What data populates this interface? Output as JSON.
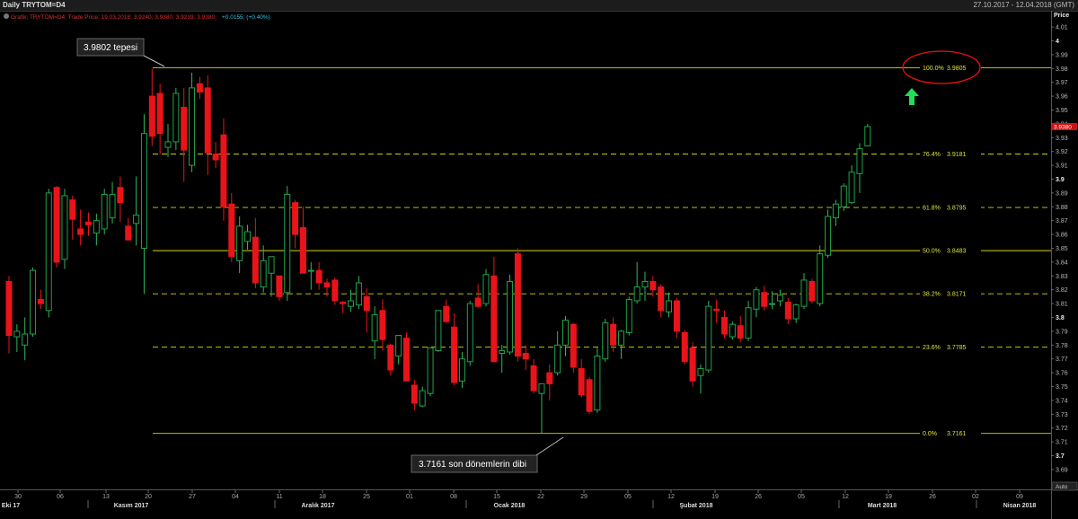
{
  "window": {
    "title": "Daily TRYTOM=D4",
    "date_range": "27.10.2017 - 12.04.2018 (GMT)"
  },
  "legend_line": {
    "prefix": "Grafik; TRYTOM=D4; Trade Price; 19.03.2018; 3.9240; 3.9380; 3.9239; 3.9380;",
    "change": "+0.0155; (+0.40%)"
  },
  "price_axis": {
    "title": "Price",
    "current_price": "3.9380",
    "ticks": [
      "4.01",
      "4",
      "3.99",
      "3.98",
      "3.97",
      "3.96",
      "3.95",
      "3.94",
      "3.93",
      "3.92",
      "3.91",
      "3.9",
      "3.89",
      "3.88",
      "3.87",
      "3.86",
      "3.85",
      "3.84",
      "3.83",
      "3.82",
      "3.81",
      "3.8",
      "3.79",
      "3.78",
      "3.77",
      "3.76",
      "3.75",
      "3.74",
      "3.73",
      "3.72",
      "3.71",
      "3.7",
      "3.69"
    ],
    "bold_ticks": [
      "4",
      "3.9",
      "3.8",
      "3.7"
    ]
  },
  "time_axis": {
    "day_ticks": [
      "30",
      "06",
      "13",
      "20",
      "27",
      "04",
      "11",
      "18",
      "25",
      "01",
      "08",
      "15",
      "22",
      "29",
      "05",
      "12",
      "19",
      "26",
      "05",
      "12",
      "19",
      "26",
      "02",
      "09"
    ],
    "month_labels": [
      "Eki 17",
      "Kasım 2017",
      "Aralık 2017",
      "Ocak 2018",
      "Şubat 2018",
      "Mart 2018",
      "Nisan 2018"
    ],
    "corner_button": "Auto"
  },
  "annotations": {
    "top_label": "3.9802 tepesi",
    "bottom_label": "3.7161 son dönemlerin dibi"
  },
  "fib_levels": [
    {
      "label": "100.0%",
      "value": "3.9805",
      "price": 3.9805,
      "style": "solid",
      "highlight": true
    },
    {
      "label": "76.4%",
      "value": "3.9181",
      "price": 3.9181,
      "style": "dashed"
    },
    {
      "label": "61.8%",
      "value": "3.8795",
      "price": 3.8795,
      "style": "dashed"
    },
    {
      "label": "50.0%",
      "value": "3.8483",
      "price": 3.8483,
      "style": "solid"
    },
    {
      "label": "38.2%",
      "value": "3.8171",
      "price": 3.8171,
      "style": "dashed"
    },
    {
      "label": "23.6%",
      "value": "3.7785",
      "price": 3.7785,
      "style": "dashed"
    },
    {
      "label": "0.0%",
      "value": "3.7161",
      "price": 3.7161,
      "style": "solid"
    }
  ],
  "colors": {
    "up": "#1fa34a",
    "down": "#e8141a",
    "fib": "#d8d800",
    "highlight_circle": "#e81010",
    "arrow": "#22dd55",
    "price_tag": "#d01010"
  },
  "chart_data": {
    "type": "candlestick",
    "title": "Daily TRYTOM=D4",
    "ylabel": "Price",
    "ylim": [
      3.685,
      4.015
    ],
    "candles": [
      {
        "o": 3.826,
        "h": 3.83,
        "l": 3.774,
        "c": 3.787
      },
      {
        "o": 3.786,
        "h": 3.795,
        "l": 3.775,
        "c": 3.79
      },
      {
        "o": 3.78,
        "h": 3.8,
        "l": 3.769,
        "c": 3.788
      },
      {
        "o": 3.788,
        "h": 3.836,
        "l": 3.786,
        "c": 3.834
      },
      {
        "o": 3.813,
        "h": 3.82,
        "l": 3.806,
        "c": 3.81
      },
      {
        "o": 3.805,
        "h": 3.893,
        "l": 3.8,
        "c": 3.89
      },
      {
        "o": 3.894,
        "h": 3.895,
        "l": 3.836,
        "c": 3.84
      },
      {
        "o": 3.842,
        "h": 3.893,
        "l": 3.835,
        "c": 3.888
      },
      {
        "o": 3.885,
        "h": 3.888,
        "l": 3.856,
        "c": 3.871
      },
      {
        "o": 3.864,
        "h": 3.878,
        "l": 3.852,
        "c": 3.86
      },
      {
        "o": 3.869,
        "h": 3.876,
        "l": 3.859,
        "c": 3.867
      },
      {
        "o": 3.861,
        "h": 3.875,
        "l": 3.852,
        "c": 3.87
      },
      {
        "o": 3.864,
        "h": 3.893,
        "l": 3.86,
        "c": 3.889
      },
      {
        "o": 3.872,
        "h": 3.898,
        "l": 3.868,
        "c": 3.889
      },
      {
        "o": 3.894,
        "h": 3.902,
        "l": 3.869,
        "c": 3.883
      },
      {
        "o": 3.866,
        "h": 3.872,
        "l": 3.861,
        "c": 3.856
      },
      {
        "o": 3.868,
        "h": 3.902,
        "l": 3.852,
        "c": 3.874
      },
      {
        "o": 3.85,
        "h": 3.947,
        "l": 3.817,
        "c": 3.933
      },
      {
        "o": 3.96,
        "h": 3.98,
        "l": 3.924,
        "c": 3.931
      },
      {
        "o": 3.962,
        "h": 3.969,
        "l": 3.918,
        "c": 3.933
      },
      {
        "o": 3.923,
        "h": 3.94,
        "l": 3.916,
        "c": 3.927
      },
      {
        "o": 3.927,
        "h": 3.966,
        "l": 3.921,
        "c": 3.962
      },
      {
        "o": 3.952,
        "h": 3.966,
        "l": 3.898,
        "c": 3.921
      },
      {
        "o": 3.91,
        "h": 3.977,
        "l": 3.905,
        "c": 3.966
      },
      {
        "o": 3.969,
        "h": 3.974,
        "l": 3.958,
        "c": 3.963
      },
      {
        "o": 3.966,
        "h": 3.975,
        "l": 3.903,
        "c": 3.919
      },
      {
        "o": 3.918,
        "h": 3.927,
        "l": 3.908,
        "c": 3.914
      },
      {
        "o": 3.932,
        "h": 3.944,
        "l": 3.87,
        "c": 3.88
      },
      {
        "o": 3.882,
        "h": 3.89,
        "l": 3.84,
        "c": 3.844
      },
      {
        "o": 3.841,
        "h": 3.873,
        "l": 3.832,
        "c": 3.866
      },
      {
        "o": 3.855,
        "h": 3.867,
        "l": 3.849,
        "c": 3.862
      },
      {
        "o": 3.858,
        "h": 3.872,
        "l": 3.821,
        "c": 3.825
      },
      {
        "o": 3.822,
        "h": 3.852,
        "l": 3.818,
        "c": 3.841
      },
      {
        "o": 3.832,
        "h": 3.844,
        "l": 3.815,
        "c": 3.844
      },
      {
        "o": 3.83,
        "h": 3.826,
        "l": 3.812,
        "c": 3.815
      },
      {
        "o": 3.818,
        "h": 3.895,
        "l": 3.812,
        "c": 3.889
      },
      {
        "o": 3.883,
        "h": 3.885,
        "l": 3.85,
        "c": 3.86
      },
      {
        "o": 3.865,
        "h": 3.88,
        "l": 3.832,
        "c": 3.832
      },
      {
        "o": 3.834,
        "h": 3.84,
        "l": 3.82,
        "c": 3.834
      },
      {
        "o": 3.834,
        "h": 3.84,
        "l": 3.82,
        "c": 3.825
      },
      {
        "o": 3.825,
        "h": 3.828,
        "l": 3.815,
        "c": 3.822
      },
      {
        "o": 3.827,
        "h": 3.829,
        "l": 3.809,
        "c": 3.812
      },
      {
        "o": 3.811,
        "h": 3.812,
        "l": 3.803,
        "c": 3.81
      },
      {
        "o": 3.808,
        "h": 3.82,
        "l": 3.804,
        "c": 3.812
      },
      {
        "o": 3.809,
        "h": 3.83,
        "l": 3.806,
        "c": 3.825
      },
      {
        "o": 3.815,
        "h": 3.821,
        "l": 3.789,
        "c": 3.805
      },
      {
        "o": 3.783,
        "h": 3.808,
        "l": 3.77,
        "c": 3.802
      },
      {
        "o": 3.805,
        "h": 3.813,
        "l": 3.776,
        "c": 3.784
      },
      {
        "o": 3.78,
        "h": 3.781,
        "l": 3.758,
        "c": 3.762
      },
      {
        "o": 3.772,
        "h": 3.786,
        "l": 3.766,
        "c": 3.787
      },
      {
        "o": 3.785,
        "h": 3.789,
        "l": 3.754,
        "c": 3.754
      },
      {
        "o": 3.751,
        "h": 3.755,
        "l": 3.733,
        "c": 3.738
      },
      {
        "o": 3.736,
        "h": 3.75,
        "l": 3.735,
        "c": 3.747
      },
      {
        "o": 3.745,
        "h": 3.777,
        "l": 3.743,
        "c": 3.778
      },
      {
        "o": 3.776,
        "h": 3.797,
        "l": 3.775,
        "c": 3.805
      },
      {
        "o": 3.808,
        "h": 3.813,
        "l": 3.796,
        "c": 3.797
      },
      {
        "o": 3.793,
        "h": 3.803,
        "l": 3.751,
        "c": 3.753
      },
      {
        "o": 3.754,
        "h": 3.775,
        "l": 3.749,
        "c": 3.77
      },
      {
        "o": 3.768,
        "h": 3.812,
        "l": 3.765,
        "c": 3.81
      },
      {
        "o": 3.814,
        "h": 3.824,
        "l": 3.807,
        "c": 3.808
      },
      {
        "o": 3.81,
        "h": 3.835,
        "l": 3.808,
        "c": 3.831
      },
      {
        "o": 3.83,
        "h": 3.844,
        "l": 3.768,
        "c": 3.768
      },
      {
        "o": 3.774,
        "h": 3.78,
        "l": 3.76,
        "c": 3.776
      },
      {
        "o": 3.775,
        "h": 3.831,
        "l": 3.773,
        "c": 3.826
      },
      {
        "o": 3.846,
        "h": 3.85,
        "l": 3.768,
        "c": 3.772
      },
      {
        "o": 3.774,
        "h": 3.78,
        "l": 3.762,
        "c": 3.77
      },
      {
        "o": 3.765,
        "h": 3.77,
        "l": 3.745,
        "c": 3.747
      },
      {
        "o": 3.745,
        "h": 3.748,
        "l": 3.716,
        "c": 3.752
      },
      {
        "o": 3.76,
        "h": 3.766,
        "l": 3.74,
        "c": 3.752
      },
      {
        "o": 3.76,
        "h": 3.79,
        "l": 3.758,
        "c": 3.78
      },
      {
        "o": 3.78,
        "h": 3.801,
        "l": 3.772,
        "c": 3.798
      },
      {
        "o": 3.795,
        "h": 3.796,
        "l": 3.76,
        "c": 3.764
      },
      {
        "o": 3.763,
        "h": 3.77,
        "l": 3.742,
        "c": 3.744
      },
      {
        "o": 3.755,
        "h": 3.757,
        "l": 3.73,
        "c": 3.732
      },
      {
        "o": 3.733,
        "h": 3.778,
        "l": 3.731,
        "c": 3.772
      },
      {
        "o": 3.77,
        "h": 3.799,
        "l": 3.768,
        "c": 3.796
      },
      {
        "o": 3.795,
        "h": 3.8,
        "l": 3.775,
        "c": 3.78
      },
      {
        "o": 3.78,
        "h": 3.791,
        "l": 3.77,
        "c": 3.79
      },
      {
        "o": 3.789,
        "h": 3.815,
        "l": 3.787,
        "c": 3.813
      },
      {
        "o": 3.812,
        "h": 3.84,
        "l": 3.81,
        "c": 3.822
      },
      {
        "o": 3.822,
        "h": 3.833,
        "l": 3.812,
        "c": 3.826
      },
      {
        "o": 3.826,
        "h": 3.83,
        "l": 3.815,
        "c": 3.82
      },
      {
        "o": 3.822,
        "h": 3.824,
        "l": 3.8,
        "c": 3.805
      },
      {
        "o": 3.804,
        "h": 3.818,
        "l": 3.8,
        "c": 3.812
      },
      {
        "o": 3.812,
        "h": 3.814,
        "l": 3.785,
        "c": 3.79
      },
      {
        "o": 3.789,
        "h": 3.791,
        "l": 3.766,
        "c": 3.768
      },
      {
        "o": 3.778,
        "h": 3.782,
        "l": 3.75,
        "c": 3.754
      },
      {
        "o": 3.758,
        "h": 3.766,
        "l": 3.745,
        "c": 3.763
      },
      {
        "o": 3.762,
        "h": 3.812,
        "l": 3.76,
        "c": 3.808
      },
      {
        "o": 3.806,
        "h": 3.813,
        "l": 3.796,
        "c": 3.805
      },
      {
        "o": 3.8,
        "h": 3.805,
        "l": 3.785,
        "c": 3.788
      },
      {
        "o": 3.786,
        "h": 3.797,
        "l": 3.784,
        "c": 3.795
      },
      {
        "o": 3.794,
        "h": 3.801,
        "l": 3.782,
        "c": 3.785
      },
      {
        "o": 3.785,
        "h": 3.812,
        "l": 3.783,
        "c": 3.807
      },
      {
        "o": 3.806,
        "h": 3.822,
        "l": 3.8,
        "c": 3.82
      },
      {
        "o": 3.818,
        "h": 3.823,
        "l": 3.805,
        "c": 3.808
      },
      {
        "o": 3.81,
        "h": 3.819,
        "l": 3.806,
        "c": 3.81
      },
      {
        "o": 3.812,
        "h": 3.82,
        "l": 3.808,
        "c": 3.816
      },
      {
        "o": 3.811,
        "h": 3.814,
        "l": 3.795,
        "c": 3.799
      },
      {
        "o": 3.799,
        "h": 3.81,
        "l": 3.796,
        "c": 3.809
      },
      {
        "o": 3.808,
        "h": 3.832,
        "l": 3.806,
        "c": 3.827
      },
      {
        "o": 3.826,
        "h": 3.828,
        "l": 3.81,
        "c": 3.812
      },
      {
        "o": 3.81,
        "h": 3.852,
        "l": 3.808,
        "c": 3.846
      },
      {
        "o": 3.845,
        "h": 3.878,
        "l": 3.843,
        "c": 3.873
      },
      {
        "o": 3.872,
        "h": 3.885,
        "l": 3.866,
        "c": 3.882
      },
      {
        "o": 3.88,
        "h": 3.897,
        "l": 3.877,
        "c": 3.895
      },
      {
        "o": 3.883,
        "h": 3.91,
        "l": 3.882,
        "c": 3.905
      },
      {
        "o": 3.904,
        "h": 3.926,
        "l": 3.89,
        "c": 3.922
      },
      {
        "o": 3.924,
        "h": 3.94,
        "l": 3.924,
        "c": 3.938
      }
    ]
  }
}
